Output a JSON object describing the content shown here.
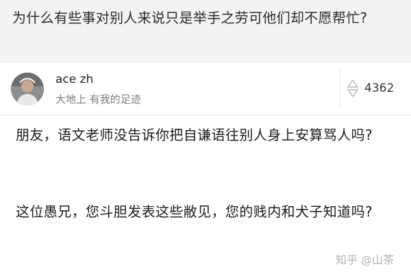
{
  "question": {
    "title": "为什么有些事对别人来说只是举手之劳可他们却不愿帮忙?"
  },
  "author": {
    "name": "ace zh",
    "bio": "大地上 有我的足迹",
    "avatar_icon": "user-avatar"
  },
  "vote": {
    "count": "4362",
    "icon": "vote-arrows-icon"
  },
  "answer": {
    "paragraphs": [
      "朋友，语文老师没告诉你把自谦语往别人身上安算骂人吗?",
      "这位愚兄，您斗胆发表这些敝见，您的贱内和犬子知道吗?"
    ]
  },
  "watermark": {
    "text": "知乎 @山茶"
  },
  "colors": {
    "header_bg": "#f3f3f3",
    "text": "#1c1c1c",
    "muted": "#7c7c7c"
  }
}
